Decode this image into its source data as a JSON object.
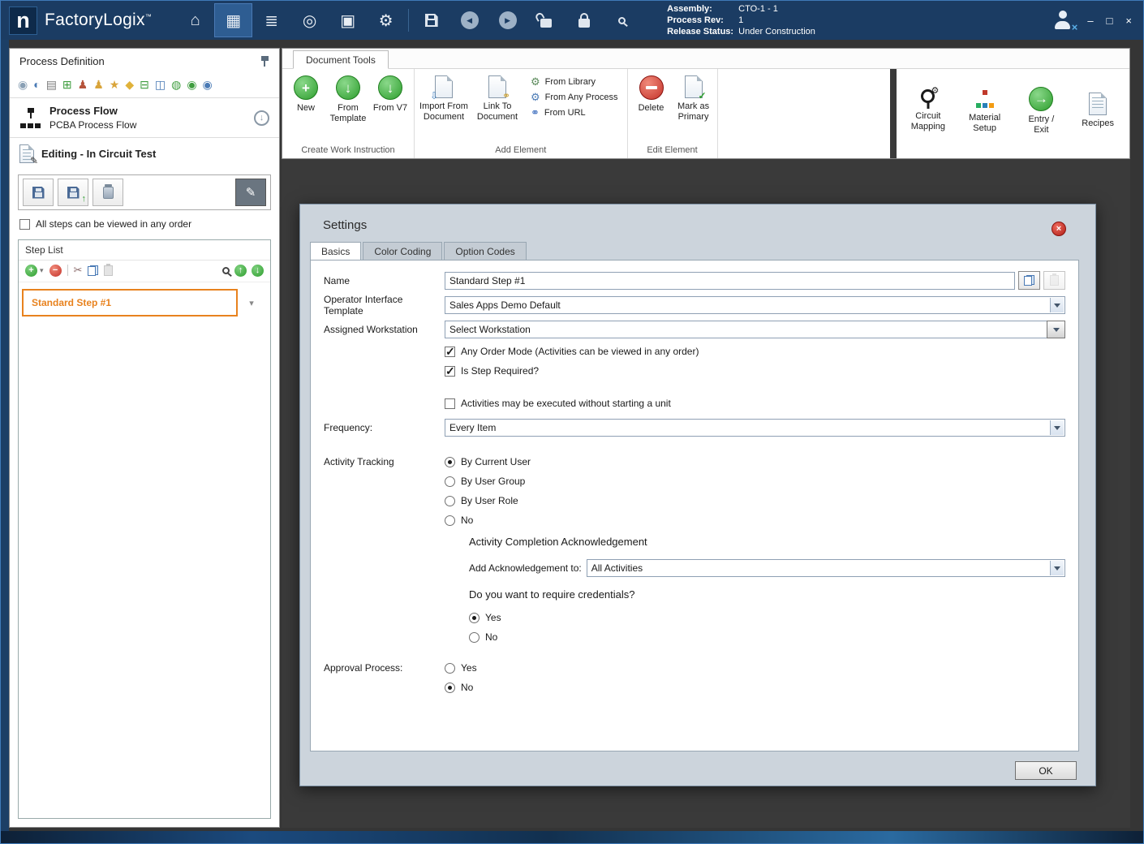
{
  "icons": {
    "home": "⌂",
    "designer": "▦",
    "process": "≣",
    "compass": "◎",
    "documents": "▣",
    "gear": "⚙",
    "back": "◀",
    "forward": "▶",
    "minimize": "–",
    "maximize": "□",
    "close": "×",
    "down_arrow": "↓",
    "up_arrow": "↑",
    "right_arrow": "→",
    "plus": "+",
    "minus": "−",
    "check": "✓",
    "chevron_down": "▾",
    "cut": "✂",
    "pencil": "✎",
    "link": "⚭",
    "gears": "⚙",
    "import_arrow": "⇩"
  },
  "titlebar": {
    "logo_letter": "n",
    "app_name": "FactoryLogix",
    "trademark": "™",
    "info": {
      "assembly_label": "Assembly:",
      "assembly_value": "CTO-1 - 1",
      "process_rev_label": "Process Rev:",
      "process_rev_value": "1",
      "release_status_label": "Release Status:",
      "release_status_value": "Under Construction"
    }
  },
  "left_panel": {
    "title": "Process Definition",
    "toolbar_icons": [
      {
        "name": "nav-back-icon",
        "glyph": "◉"
      },
      {
        "name": "web-icon",
        "glyph": "◐"
      },
      {
        "name": "print-icon",
        "glyph": "▤"
      },
      {
        "name": "plugin-icon",
        "glyph": "⊞"
      },
      {
        "name": "users-icon",
        "glyph": "♟"
      },
      {
        "name": "user-icon",
        "glyph": "♟"
      },
      {
        "name": "star-icon",
        "glyph": "★"
      },
      {
        "name": "burst-icon",
        "glyph": "◆"
      },
      {
        "name": "export-icon",
        "glyph": "⊟"
      },
      {
        "name": "package-icon",
        "glyph": "◫"
      },
      {
        "name": "sync-icon",
        "glyph": "◍"
      },
      {
        "name": "play-icon",
        "glyph": "◉"
      },
      {
        "name": "info-icon",
        "glyph": "◉"
      }
    ],
    "process_flow": {
      "title": "Process Flow",
      "subtitle": "PCBA Process Flow"
    },
    "editing_label": "Editing - In Circuit Test",
    "order_checkbox_label": "All steps can be viewed in any order",
    "step_list": {
      "title": "Step List",
      "steps": [
        {
          "name": "Standard Step #1"
        }
      ]
    }
  },
  "ribbon": {
    "tab_label": "Document Tools",
    "groups": {
      "create": {
        "label": "Create Work Instruction",
        "new": "New",
        "from_template": "From Template",
        "from_v7": "From V7"
      },
      "add": {
        "label": "Add Element",
        "import_from_document": "Import From Document",
        "link_to_document": "Link To Document",
        "from_library": "From Library",
        "from_any_process": "From Any Process",
        "from_url": "From URL"
      },
      "edit": {
        "label": "Edit Element",
        "delete": "Delete",
        "mark_as_primary": "Mark as Primary"
      }
    },
    "right_buttons": {
      "circuit_mapping": "Circuit Mapping",
      "material_setup": "Material Setup",
      "entry_exit": "Entry / Exit",
      "recipes": "Recipes"
    }
  },
  "dialog": {
    "title": "Settings",
    "tabs": [
      "Basics",
      "Color Coding",
      "Option Codes"
    ],
    "name_label": "Name",
    "name_value": "Standard Step #1",
    "oit_label": "Operator Interface Template",
    "oit_value": "Sales Apps Demo Default",
    "workstation_label": "Assigned Workstation",
    "workstation_value": "Select Workstation",
    "any_order_label": "Any Order Mode (Activities can be viewed in any order)",
    "step_required_label": "Is Step Required?",
    "activities_label": "Activities may be executed without starting a unit",
    "frequency_label": "Frequency:",
    "frequency_value": "Every Item",
    "tracking_label": "Activity Tracking",
    "tracking_options": [
      "By Current User",
      "By User Group",
      "By User Role",
      "No"
    ],
    "ack_heading": "Activity Completion Acknowledgement",
    "ack_label": "Add Acknowledgement to:",
    "ack_value": "All Activities",
    "credentials_heading": "Do you want to require credentials?",
    "credentials_yes": "Yes",
    "credentials_no": "No",
    "approval_label": "Approval Process:",
    "approval_yes": "Yes",
    "approval_no": "No",
    "ok_label": "OK"
  },
  "colors": {
    "accent_orange": "#E8821E",
    "titlebar_blue": "#1B3C63",
    "icon_green": "#2E9E2E",
    "icon_red": "#C4322A"
  }
}
